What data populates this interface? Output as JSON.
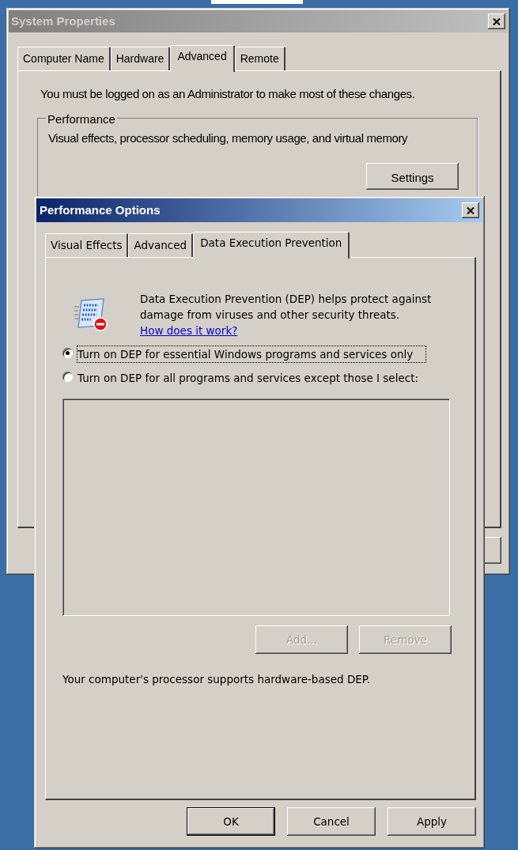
{
  "system_properties": {
    "title": "System Properties",
    "tabs": [
      {
        "label": "Computer Name",
        "selected": false
      },
      {
        "label": "Hardware",
        "selected": false
      },
      {
        "label": "Advanced",
        "selected": true
      },
      {
        "label": "Remote",
        "selected": false
      }
    ],
    "notice": "You must be logged on as an Administrator to make most of these changes.",
    "performance_group": {
      "label": "Performance",
      "description": "Visual effects, processor scheduling, memory usage, and virtual memory",
      "button": "Settings"
    }
  },
  "performance_options": {
    "title": "Performance Options",
    "tabs": [
      {
        "label": "Visual Effects",
        "selected": false
      },
      {
        "label": "Advanced",
        "selected": false
      },
      {
        "label": "Data Execution Prevention",
        "selected": true
      }
    ],
    "description": "Data Execution Prevention (DEP) helps protect against damage from viruses and other security threats.",
    "link": "How does it work?",
    "options": [
      {
        "label": "Turn on DEP for essential Windows programs and services only",
        "selected": true,
        "focused": true
      },
      {
        "label": "Turn on DEP for all programs and services except those I select:",
        "selected": false,
        "focused": false
      }
    ],
    "list_buttons": [
      {
        "label": "Add...",
        "disabled": true
      },
      {
        "label": "Remove",
        "disabled": true
      }
    ],
    "status": "Your computer's processor supports hardware-based DEP.",
    "dialog_buttons": [
      {
        "label": "OK",
        "default": true
      },
      {
        "label": "Cancel",
        "default": false
      },
      {
        "label": "Apply",
        "default": false
      }
    ]
  }
}
